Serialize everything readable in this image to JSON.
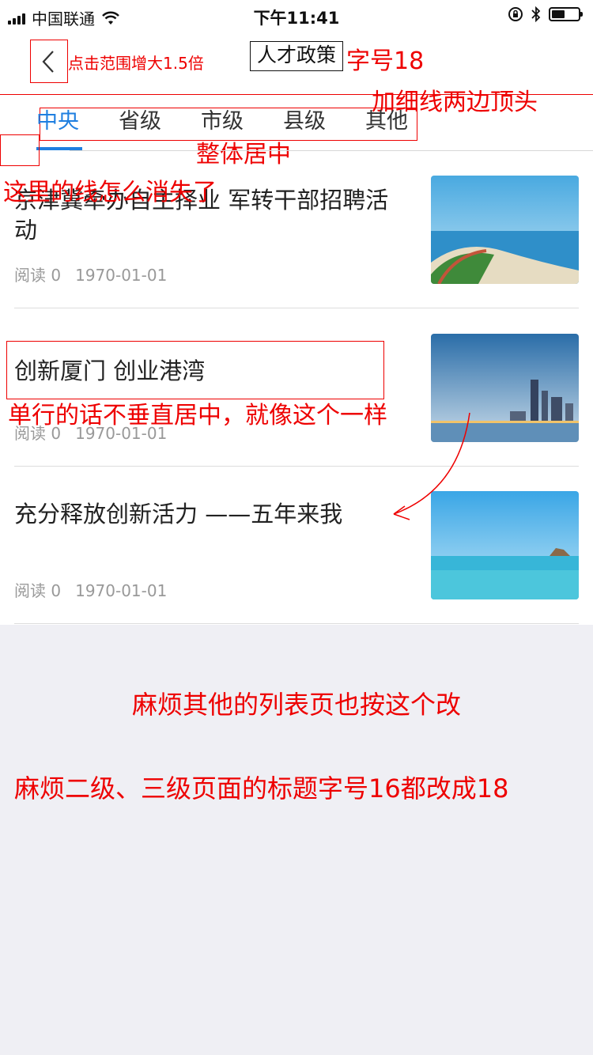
{
  "status_bar": {
    "carrier": "中国联通",
    "time": "下午11:41"
  },
  "nav": {
    "title": "人才政策"
  },
  "tabs": [
    "中央",
    "省级",
    "市级",
    "县级",
    "其他"
  ],
  "articles": [
    {
      "title": "京津冀牵办自主择业 军转干部招聘活动",
      "reads": "阅读 0",
      "date": "1970-01-01"
    },
    {
      "title": "创新厦门 创业港湾",
      "reads": "阅读 0",
      "date": "1970-01-01"
    },
    {
      "title": "充分释放创新活力 ——五年来我",
      "reads": "阅读 0",
      "date": "1970-01-01"
    }
  ],
  "annotations": {
    "tap_area": "点击范围增大1.5倍",
    "font_size": "字号18",
    "thin_line": "加细线两边顶头",
    "center": "整体居中",
    "line_missing": "这里的线怎么消失了",
    "single_line": "单行的话不垂直居中，就像这个一样",
    "other_lists": "麻烦其他的列表页也按这个改",
    "title_size": "麻烦二级、三级页面的标题字号16都改成18"
  },
  "colors": {
    "accent": "#1f7fe0",
    "annotation": "#e00000",
    "background": "#efeff4"
  }
}
